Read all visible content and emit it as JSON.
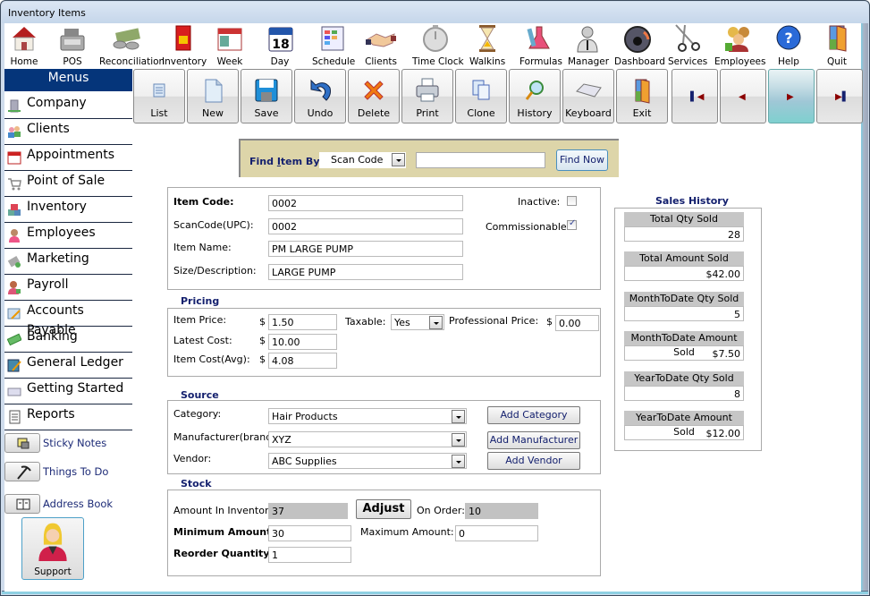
{
  "window": {
    "title": "Inventory Items"
  },
  "topbar": [
    {
      "label": "Home",
      "icon": "home-icon"
    },
    {
      "label": "POS",
      "icon": "cash-register-icon"
    },
    {
      "label": "Reconciliation",
      "icon": "money-icon"
    },
    {
      "label": "Inventory",
      "icon": "product-box-icon"
    },
    {
      "label": "Week",
      "icon": "calendar-week-icon"
    },
    {
      "label": "Day",
      "icon": "calendar-day-icon"
    },
    {
      "label": "Schedule",
      "icon": "schedule-icon"
    },
    {
      "label": "Clients",
      "icon": "handshake-icon"
    },
    {
      "label": "Time Clock",
      "icon": "stopwatch-icon"
    },
    {
      "label": "Walkins",
      "icon": "hourglass-icon"
    },
    {
      "label": "Formulas",
      "icon": "flask-icon"
    },
    {
      "label": "Manager",
      "icon": "manager-icon"
    },
    {
      "label": "Dashboard",
      "icon": "gauge-icon"
    },
    {
      "label": "Services",
      "icon": "scissors-icon"
    },
    {
      "label": "Employees",
      "icon": "people-icon"
    },
    {
      "label": "Help",
      "icon": "help-icon"
    },
    {
      "label": "Quit",
      "icon": "door-icon"
    }
  ],
  "calendar_day_number": "18",
  "menus": {
    "title": "Menus",
    "items": [
      {
        "label": "Company",
        "icon": "building-icon"
      },
      {
        "label": "Clients",
        "icon": "clients-icon"
      },
      {
        "label": "Appointments",
        "icon": "calendar-icon"
      },
      {
        "label": "Point of Sale",
        "icon": "cart-icon"
      },
      {
        "label": "Inventory",
        "icon": "boxes-icon"
      },
      {
        "label": "Employees",
        "icon": "employee-icon"
      },
      {
        "label": "Marketing",
        "icon": "marketing-icon"
      },
      {
        "label": "Payroll",
        "icon": "payroll-icon"
      },
      {
        "label": "Accounts Payable",
        "icon": "invoice-icon"
      },
      {
        "label": "Banking",
        "icon": "cash-icon"
      },
      {
        "label": "General Ledger",
        "icon": "ledger-icon"
      },
      {
        "label": "Getting Started",
        "icon": "keyboard-icon"
      },
      {
        "label": "Reports",
        "icon": "report-icon"
      }
    ]
  },
  "tools": [
    {
      "label": "Sticky Notes",
      "icon": "sticky-note-icon"
    },
    {
      "label": "Things To Do",
      "icon": "pickaxe-icon"
    },
    {
      "label": "Address Book",
      "icon": "address-book-icon"
    }
  ],
  "support": {
    "label": "Support"
  },
  "actions": [
    {
      "label": "List",
      "icon": "list-icon"
    },
    {
      "label": "New",
      "icon": "new-document-icon"
    },
    {
      "label": "Save",
      "icon": "floppy-icon"
    },
    {
      "label": "Undo",
      "icon": "undo-icon"
    },
    {
      "label": "Delete",
      "icon": "delete-x-icon"
    },
    {
      "label": "Print",
      "icon": "printer-icon"
    },
    {
      "label": "Clone",
      "icon": "clone-icon"
    },
    {
      "label": "History",
      "icon": "history-icon"
    },
    {
      "label": "Keyboard",
      "icon": "keyboard-icon"
    },
    {
      "label": "Exit",
      "icon": "exit-door-icon"
    }
  ],
  "nav": [
    {
      "name": "first-record-button",
      "glyph": "⏮"
    },
    {
      "name": "previous-record-button",
      "glyph": "◀"
    },
    {
      "name": "next-record-button",
      "glyph": "▶"
    },
    {
      "name": "last-record-button",
      "glyph": "⏭"
    }
  ],
  "find": {
    "label_pre": "Find ",
    "label_ul": "I",
    "label_post": "tem By:",
    "by_value": "Scan Code",
    "query": "",
    "button": "Find Now"
  },
  "item": {
    "item_code_label": "Item Code:",
    "item_code": "0002",
    "scan_code_label": "ScanCode(UPC):",
    "scan_code": "0002",
    "item_name_label": "Item Name:",
    "item_name": "PM LARGE PUMP",
    "size_label": "Size/Description:",
    "size": "LARGE PUMP",
    "inactive_label": "Inactive:",
    "inactive": false,
    "commissionable_label": "Commissionable:",
    "commissionable": true
  },
  "pricing": {
    "title": "Pricing",
    "currency": "$",
    "item_price_label": "Item Price:",
    "item_price": "1.50",
    "latest_cost_label": "Latest Cost:",
    "latest_cost": "10.00",
    "avg_cost_label": "Item Cost(Avg):",
    "avg_cost": "4.08",
    "taxable_label": "Taxable:",
    "taxable": "Yes",
    "pro_price_label": "Professional Price:",
    "pro_price": "0.00"
  },
  "source": {
    "title": "Source",
    "category_label": "Category:",
    "category": "Hair Products",
    "manufacturer_label": "Manufacturer(brand)",
    "manufacturer": "XYZ",
    "vendor_label": "Vendor:",
    "vendor": "ABC Supplies",
    "add_category": "Add Category",
    "add_manufacturer": "Add Manufacturer",
    "add_vendor": "Add Vendor"
  },
  "stock": {
    "title": "Stock",
    "in_inventory_label": "Amount In Inventory",
    "in_inventory": "37",
    "adjust": "Adjust",
    "on_order_label": "On Order:",
    "on_order": "10",
    "min_label": "Minimum Amount:",
    "min": "30",
    "max_label": "Maximum Amount:",
    "max": "0",
    "reorder_label": "Reorder Quantity:",
    "reorder": "1"
  },
  "sales_history": {
    "title": "Sales History",
    "rows": [
      {
        "label": "Total Qty Sold",
        "value": "28"
      },
      {
        "label": "Total Amount Sold",
        "value": "$42.00"
      },
      {
        "label": "MonthToDate Qty Sold",
        "value": "5"
      },
      {
        "label": "MonthToDate Amount Sold",
        "value": "$7.50"
      },
      {
        "label": "YearToDate Qty Sold",
        "value": "8"
      },
      {
        "label": "YearToDate Amount Sold",
        "value": "$12.00"
      }
    ]
  }
}
